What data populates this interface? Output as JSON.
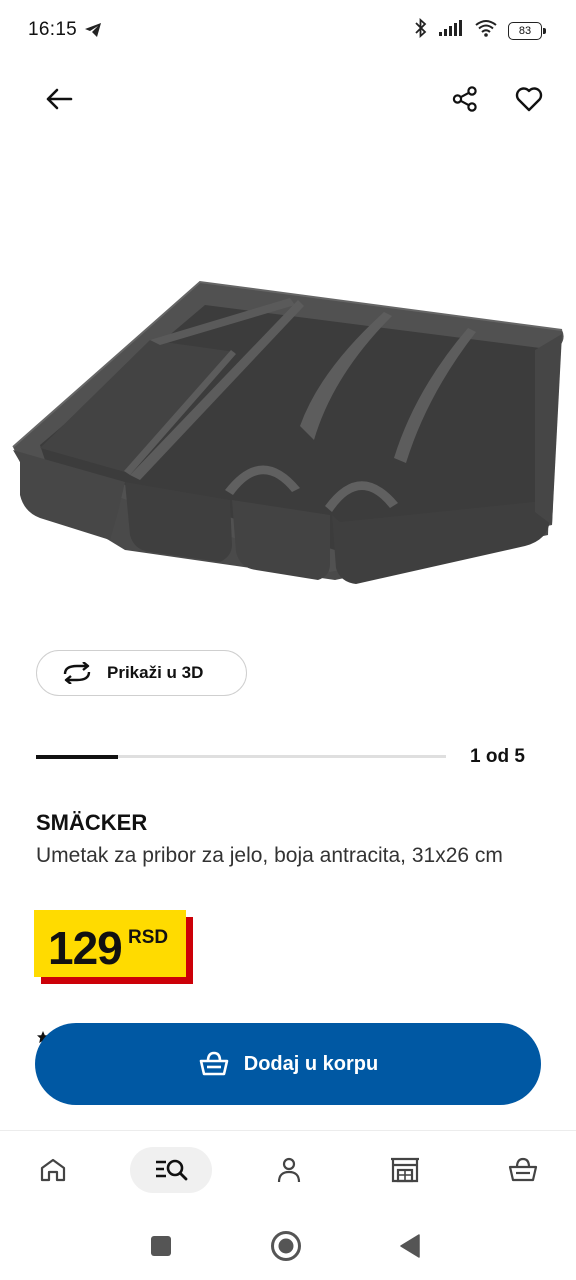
{
  "status_bar": {
    "time": "16:15",
    "battery": "83",
    "icons": [
      "telegram-send-icon",
      "bluetooth-icon",
      "signal-icon",
      "wifi-icon",
      "battery-icon"
    ]
  },
  "top_bar": {
    "icons": [
      "arrow-left-icon",
      "share-icon",
      "heart-icon"
    ]
  },
  "view_3d": {
    "label": "Prikaži u 3D",
    "icon": "rotate-3d-icon"
  },
  "gallery": {
    "position_label": "1 od 5",
    "progress_fraction": 0.2
  },
  "product": {
    "name": "SMÄCKER",
    "description": "Umetak za pribor za jelo, boja antracita, 31x26 cm",
    "price_value": "129",
    "price_currency": "RSD"
  },
  "cart_button": {
    "label": "Dodaj u korpu",
    "icon": "basket-icon"
  },
  "bottom_nav": {
    "items": [
      "home-icon",
      "search-list-icon",
      "user-icon",
      "store-icon",
      "basket-icon"
    ],
    "active_index": 1
  },
  "system_nav": {
    "icons": [
      "recents-square-icon",
      "home-circle-icon",
      "back-triangle-icon"
    ]
  },
  "colors": {
    "brand_blue": "#0058a3",
    "price_yellow": "#ffdb00",
    "price_red": "#cc0008"
  }
}
